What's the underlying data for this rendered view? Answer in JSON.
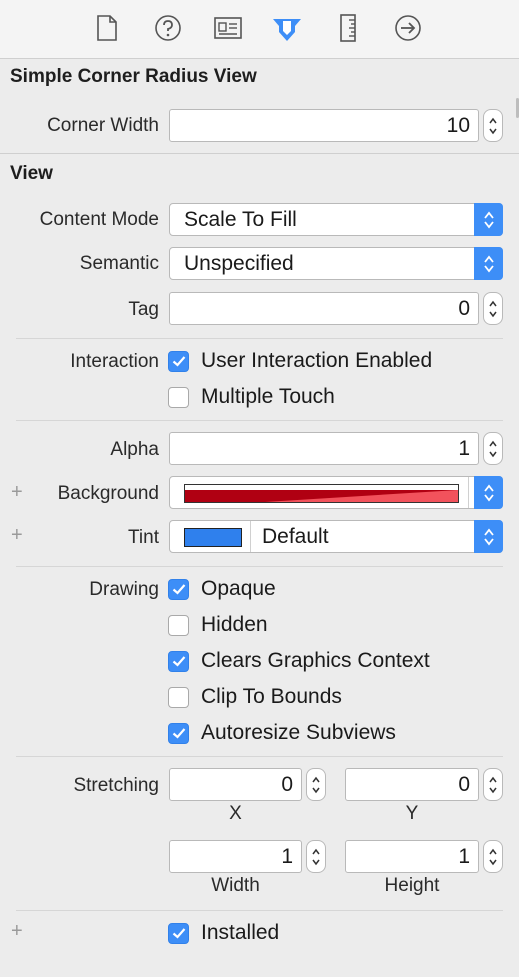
{
  "toolbar": {
    "icons": [
      "file-inspector-icon",
      "quick-help-icon",
      "identity-inspector-icon",
      "attributes-inspector-icon",
      "size-inspector-icon",
      "connections-inspector-icon"
    ],
    "accent": "#3d8ef7"
  },
  "simple_corner": {
    "title": "Simple Corner Radius View",
    "corner_width_label": "Corner Width",
    "corner_width_value": "10"
  },
  "view": {
    "title": "View",
    "content_mode_label": "Content Mode",
    "content_mode_value": "Scale To Fill",
    "semantic_label": "Semantic",
    "semantic_value": "Unspecified",
    "tag_label": "Tag",
    "tag_value": "0",
    "interaction_label": "Interaction",
    "user_interaction_label": "User Interaction Enabled",
    "user_interaction_checked": true,
    "multiple_touch_label": "Multiple Touch",
    "multiple_touch_checked": false,
    "alpha_label": "Alpha",
    "alpha_value": "1",
    "background_label": "Background",
    "background_color": "#b00012",
    "tint_label": "Tint",
    "tint_color": "#2f80ed",
    "tint_value": "Default",
    "drawing_label": "Drawing",
    "opaque_label": "Opaque",
    "opaque_checked": true,
    "hidden_label": "Hidden",
    "hidden_checked": false,
    "clears_label": "Clears Graphics Context",
    "clears_checked": true,
    "clip_label": "Clip To Bounds",
    "clip_checked": false,
    "autoresize_label": "Autoresize Subviews",
    "autoresize_checked": true,
    "stretching_label": "Stretching",
    "stretch_x_value": "0",
    "stretch_y_value": "0",
    "stretch_x_label": "X",
    "stretch_y_label": "Y",
    "stretch_w_value": "1",
    "stretch_h_value": "1",
    "stretch_w_label": "Width",
    "stretch_h_label": "Height",
    "installed_label": "Installed",
    "installed_checked": true
  },
  "plus_symbol": "+"
}
